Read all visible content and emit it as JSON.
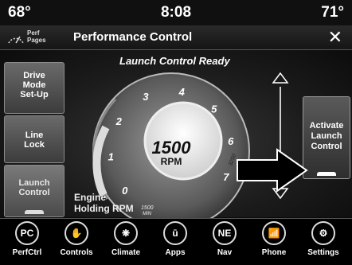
{
  "status_bar": {
    "temp_left": "68°",
    "time": "8:08",
    "temp_right": "71°"
  },
  "header": {
    "perf_pages_label_1": "Perf",
    "perf_pages_label_2": "Pages",
    "title": "Performance Control"
  },
  "main": {
    "status_message": "Launch Control Ready",
    "side_buttons": [
      {
        "lines": [
          "Drive",
          "Mode",
          "Set-Up"
        ]
      },
      {
        "lines": [
          "Line",
          "Lock"
        ]
      },
      {
        "lines": [
          "Launch",
          "Control"
        ]
      }
    ],
    "activate_button": {
      "lines": [
        "Activate",
        "Launch",
        "Control"
      ]
    },
    "engine_label": {
      "line1": "Engine",
      "line2": "Holding RPM"
    },
    "gauge": {
      "ticks": [
        "0",
        "1",
        "2",
        "3",
        "4",
        "5",
        "6",
        "7"
      ],
      "rpm_value": "1500",
      "rpm_unit": "RPM",
      "min_label": "1500",
      "min_sub": "MIN",
      "max_label": "3250",
      "max_sub": "MAX",
      "level_fraction": 0.2
    }
  },
  "nav": [
    {
      "label": "PerfCtrl",
      "icon": "perfctrl-icon",
      "glyph": "PC"
    },
    {
      "label": "Controls",
      "icon": "controls-icon",
      "glyph": "✋"
    },
    {
      "label": "Climate",
      "icon": "climate-icon",
      "glyph": "❋"
    },
    {
      "label": "Apps",
      "icon": "apps-icon",
      "glyph": "ū"
    },
    {
      "label": "Nav",
      "icon": "nav-compass-icon",
      "glyph": "NE"
    },
    {
      "label": "Phone",
      "icon": "phone-icon",
      "glyph": "📶"
    },
    {
      "label": "Settings",
      "icon": "settings-gear-icon",
      "glyph": "⚙"
    }
  ]
}
